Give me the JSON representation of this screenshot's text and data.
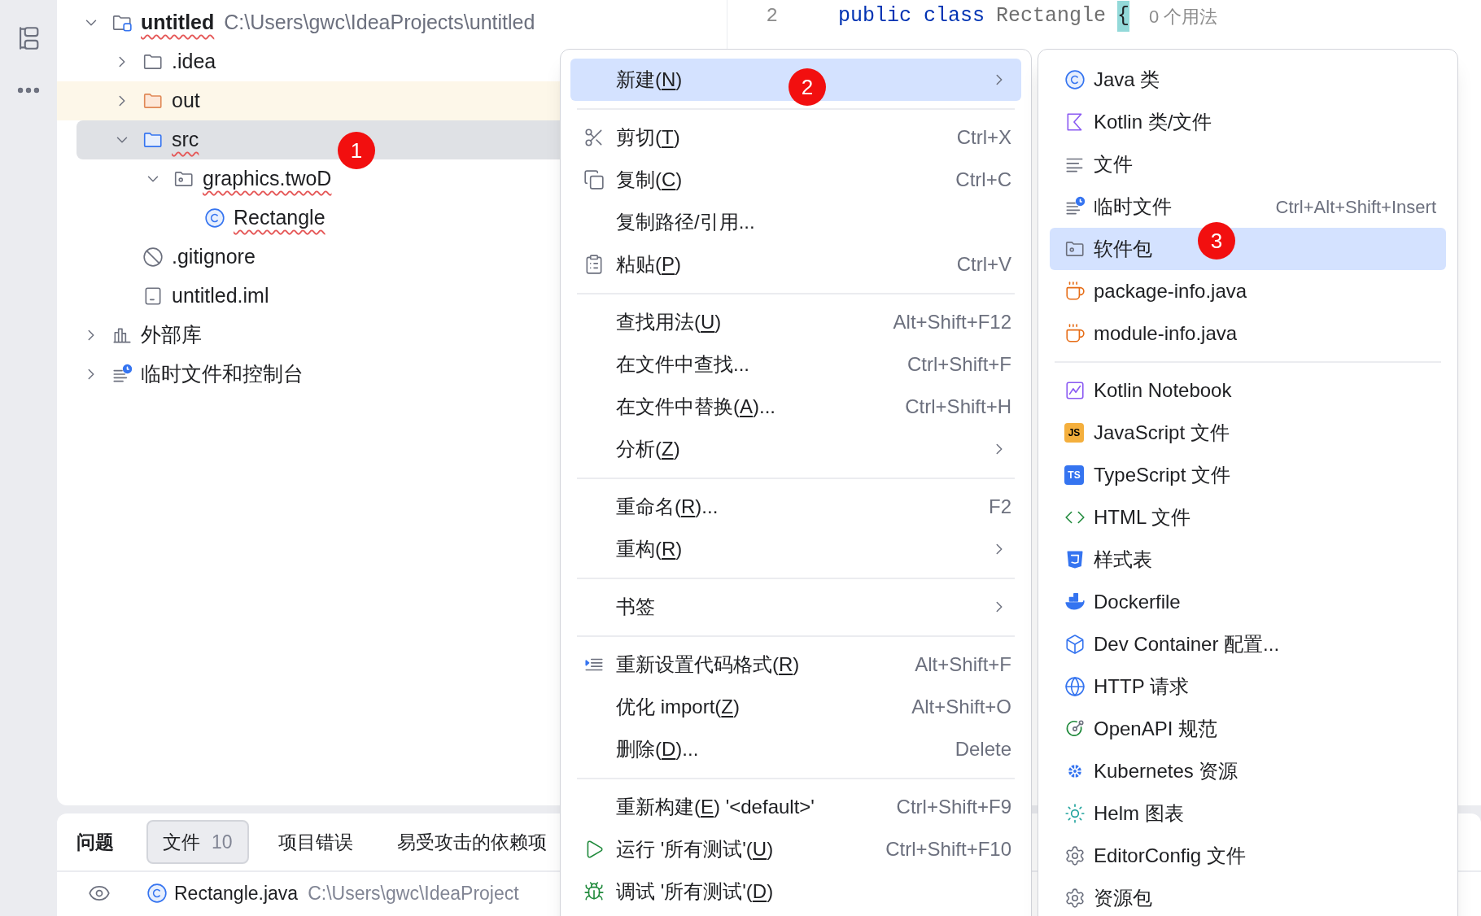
{
  "project_tree": {
    "items": [
      {
        "label": "untitled",
        "path": "C:\\Users\\gwc\\IdeaProjects\\untitled",
        "kind": "project",
        "expanded": true,
        "error_underline": true,
        "selected": false,
        "children": [
          {
            "label": ".idea",
            "kind": "folder",
            "expanded": false,
            "error_underline": false,
            "selected": false
          },
          {
            "label": "out",
            "kind": "excluded_folder",
            "expanded": false,
            "error_underline": false,
            "selected": false
          },
          {
            "label": "src",
            "kind": "source_folder",
            "expanded": true,
            "error_underline": true,
            "selected": true,
            "badge": "1",
            "children": [
              {
                "label": "graphics.twoD",
                "kind": "package",
                "expanded": true,
                "error_underline": true,
                "selected": false,
                "children": [
                  {
                    "label": "Rectangle",
                    "kind": "class",
                    "error_underline": true,
                    "selected": false
                  }
                ]
              }
            ]
          },
          {
            "label": ".gitignore",
            "kind": "ignore",
            "error_underline": false,
            "selected": false
          },
          {
            "label": "untitled.iml",
            "kind": "module_file",
            "error_underline": false,
            "selected": false
          }
        ]
      },
      {
        "label": "外部库",
        "kind": "library",
        "expanded": false,
        "error_underline": false,
        "selected": false
      },
      {
        "label": "临时文件和控制台",
        "kind": "scratches",
        "expanded": false,
        "error_underline": false,
        "selected": false
      }
    ]
  },
  "editor": {
    "line_number": "2",
    "tokens": [
      {
        "kind": "keyword",
        "text": "public class"
      },
      {
        "kind": "identifier",
        "text": "Rectangle"
      },
      {
        "kind": "brace",
        "text": "{"
      }
    ],
    "hint": "0 个用法"
  },
  "problems_panel": {
    "title": "问题",
    "tabs": [
      {
        "label": "文件",
        "count": "10",
        "selected": true
      },
      {
        "label": "项目错误",
        "selected": false
      },
      {
        "label": "易受攻击的依赖项",
        "selected": false
      }
    ],
    "rows": [
      {
        "kind": "class",
        "file": "Rectangle.java",
        "path": "C:\\Users\\gwc\\IdeaProject"
      }
    ]
  },
  "context_menu": {
    "items": [
      {
        "kind": "plain",
        "parts": [
          "新建(",
          "N",
          ")"
        ],
        "has_submenu": true,
        "selected": true,
        "badge": "2"
      },
      {
        "kind": "separator"
      },
      {
        "kind": "scissors",
        "parts": [
          "剪切(",
          "T",
          ")"
        ],
        "shortcut": "Ctrl+X",
        "selected": false
      },
      {
        "kind": "copy",
        "parts": [
          "复制(",
          "C",
          ")"
        ],
        "shortcut": "Ctrl+C",
        "selected": false
      },
      {
        "kind": "plain",
        "parts": [
          "复制路径/引用..."
        ],
        "selected": false
      },
      {
        "kind": "paste",
        "parts": [
          "粘贴(",
          "P",
          ")"
        ],
        "shortcut": "Ctrl+V",
        "selected": false
      },
      {
        "kind": "separator"
      },
      {
        "kind": "plain",
        "parts": [
          "查找用法(",
          "U",
          ")"
        ],
        "shortcut": "Alt+Shift+F12",
        "selected": false
      },
      {
        "kind": "plain",
        "parts": [
          "在文件中查找..."
        ],
        "shortcut": "Ctrl+Shift+F",
        "selected": false
      },
      {
        "kind": "plain",
        "parts": [
          "在文件中替换(",
          "A",
          ")..."
        ],
        "shortcut": "Ctrl+Shift+H",
        "selected": false
      },
      {
        "kind": "plain",
        "parts": [
          "分析(",
          "Z",
          ")"
        ],
        "has_submenu": true,
        "selected": false
      },
      {
        "kind": "separator"
      },
      {
        "kind": "plain",
        "parts": [
          "重命名(",
          "R",
          ")..."
        ],
        "shortcut": "F2",
        "selected": false
      },
      {
        "kind": "plain",
        "parts": [
          "重构(",
          "R",
          ")"
        ],
        "has_submenu": true,
        "selected": false
      },
      {
        "kind": "separator"
      },
      {
        "kind": "plain",
        "parts": [
          "书签"
        ],
        "has_submenu": true,
        "selected": false
      },
      {
        "kind": "separator"
      },
      {
        "kind": "reformat",
        "parts": [
          "重新设置代码格式(",
          "R",
          ")"
        ],
        "shortcut": "Alt+Shift+F",
        "selected": false
      },
      {
        "kind": "plain",
        "parts": [
          "优化 import(",
          "Z",
          ")"
        ],
        "shortcut": "Alt+Shift+O",
        "selected": false
      },
      {
        "kind": "plain",
        "parts": [
          "删除(",
          "D",
          ")..."
        ],
        "shortcut": "Delete",
        "selected": false
      },
      {
        "kind": "separator"
      },
      {
        "kind": "plain",
        "parts": [
          "重新构建(",
          "E",
          ") '<default>'"
        ],
        "shortcut": "Ctrl+Shift+F9",
        "selected": false
      },
      {
        "kind": "run",
        "parts": [
          "运行 '所有测试'(",
          "U",
          ")"
        ],
        "shortcut": "Ctrl+Shift+F10",
        "selected": false
      },
      {
        "kind": "debug",
        "parts": [
          "调试 '所有测试'(",
          "D",
          ")"
        ],
        "selected": false
      }
    ]
  },
  "new_submenu": {
    "items": [
      {
        "kind": "java_class",
        "label": "Java 类",
        "selected": false
      },
      {
        "kind": "kotlin",
        "label": "Kotlin 类/文件",
        "selected": false
      },
      {
        "kind": "text_file",
        "label": "文件",
        "selected": false
      },
      {
        "kind": "scratch",
        "label": "临时文件",
        "shortcut": "Ctrl+Alt+Shift+Insert",
        "selected": false
      },
      {
        "kind": "package",
        "label": "软件包",
        "selected": true,
        "badge": "3"
      },
      {
        "kind": "java_info",
        "label": "package-info.java",
        "selected": false
      },
      {
        "kind": "java_info",
        "label": "module-info.java",
        "selected": false
      },
      {
        "kind": "separator"
      },
      {
        "kind": "kotlin_notebook",
        "label": "Kotlin Notebook",
        "selected": false
      },
      {
        "kind": "text_badge",
        "icon_text": "JS",
        "color": "#f4af3d",
        "label": "JavaScript 文件",
        "selected": false
      },
      {
        "kind": "text_badge",
        "icon_text": "TS",
        "color": "#3574f0",
        "label": "TypeScript 文件",
        "selected": false
      },
      {
        "kind": "html",
        "label": "HTML 文件",
        "selected": false
      },
      {
        "kind": "css",
        "label": "样式表",
        "selected": false
      },
      {
        "kind": "docker",
        "label": "Dockerfile",
        "selected": false
      },
      {
        "kind": "devcontainer",
        "label": "Dev Container 配置...",
        "selected": false
      },
      {
        "kind": "http",
        "label": "HTTP 请求",
        "selected": false
      },
      {
        "kind": "openapi",
        "label": "OpenAPI 规范",
        "selected": false
      },
      {
        "kind": "kubernetes",
        "label": "Kubernetes 资源",
        "selected": false
      },
      {
        "kind": "helm",
        "label": "Helm 图表",
        "selected": false
      },
      {
        "kind": "gear",
        "label": "EditorConfig 文件",
        "selected": false
      },
      {
        "kind": "gear",
        "label": "资源包",
        "selected": false
      }
    ]
  }
}
